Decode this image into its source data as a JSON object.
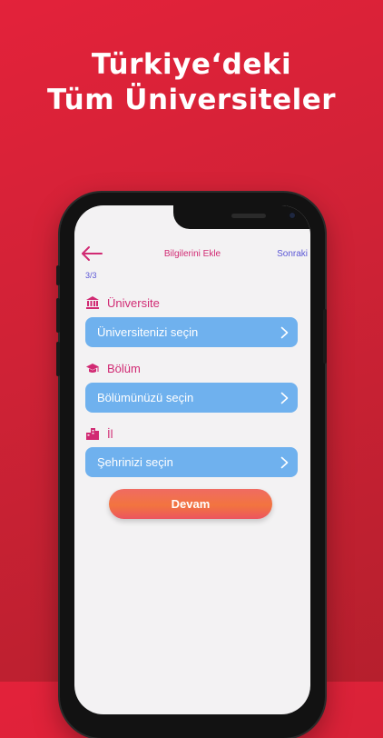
{
  "promo": {
    "line1": "Türkiye‘deki",
    "line2": "Tüm Üniversiteler"
  },
  "nav": {
    "back_icon": "arrow-left-icon",
    "title": "Bilgilerini Ekle",
    "next_label": "Sonraki",
    "step": "3/3"
  },
  "sections": {
    "university": {
      "label": "Üniversite",
      "icon": "university-building-icon",
      "placeholder": "Üniversitenizi seçin"
    },
    "department": {
      "label": "Bölüm",
      "icon": "graduation-cap-icon",
      "placeholder": "Bölümünüzü seçin"
    },
    "city": {
      "label": "İl",
      "icon": "city-buildings-icon",
      "placeholder": "Şehrinizi seçin"
    }
  },
  "cta": {
    "label": "Devam"
  },
  "colors": {
    "background": "#d02236",
    "accent_pink": "#d12a73",
    "accent_purple": "#5b57d6",
    "select_blue": "#6fb1ee",
    "button_orange": "#f2743f"
  }
}
